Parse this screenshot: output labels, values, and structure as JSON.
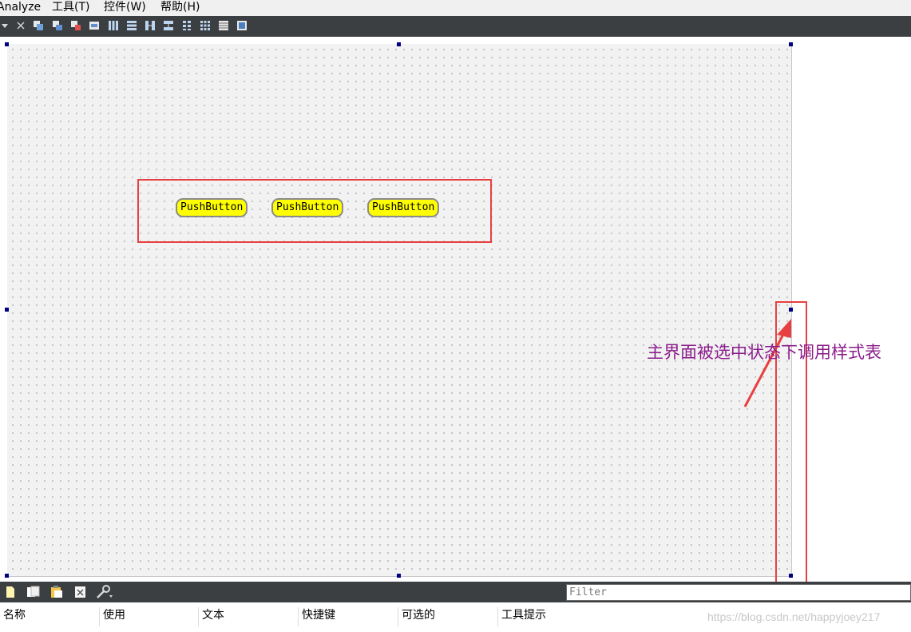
{
  "menubar": {
    "items": [
      {
        "label": "Analyze"
      },
      {
        "label": "工具(T)"
      },
      {
        "label": "控件(W)"
      },
      {
        "label": "帮助(H)"
      }
    ]
  },
  "toolbar": {
    "icons": [
      "dropdown-arrow-icon",
      "close-icon",
      "edit-widgets-icon",
      "edit-signals-slots-icon",
      "edit-buddies-icon",
      "edit-tab-order-icon",
      "layout-horizontal-icon",
      "layout-vertical-icon",
      "layout-horizontal-splitter-icon",
      "layout-vertical-splitter-icon",
      "layout-form-icon",
      "layout-grid-icon",
      "break-layout-icon",
      "adjust-size-icon"
    ]
  },
  "form": {
    "buttons": [
      {
        "label": "PushButton"
      },
      {
        "label": "PushButton"
      },
      {
        "label": "PushButton"
      }
    ],
    "button_color": "#ffff00"
  },
  "annotation": {
    "text": "主界面被选中状态下调用样式表",
    "color": "#8b1c8c",
    "box_color": "#e84040"
  },
  "action_editor": {
    "icons": [
      "new-action-icon",
      "copy-action-icon",
      "paste-action-icon",
      "delete-action-icon",
      "configure-wrench-icon"
    ],
    "filter_placeholder": "Filter",
    "columns": [
      "名称",
      "使用",
      "文本",
      "快捷键",
      "可选的",
      "工具提示"
    ]
  },
  "watermark": "https://blog.csdn.net/happyjoey217"
}
